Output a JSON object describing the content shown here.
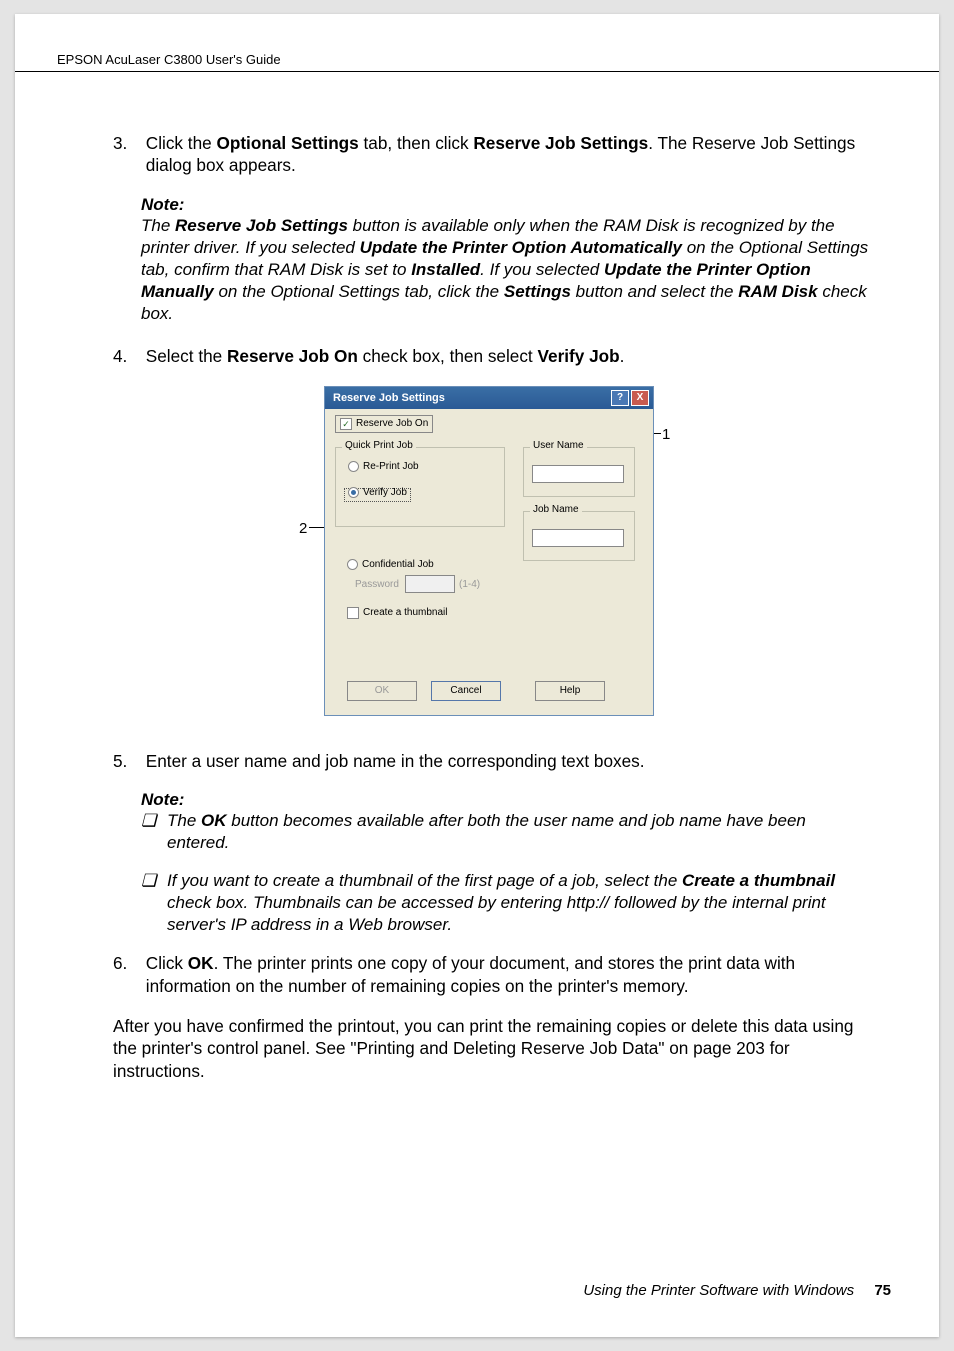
{
  "header": "EPSON AcuLaser C3800     User's Guide",
  "step3_num": "3.",
  "step3_text_a": "Click the ",
  "step3_bold_a": "Optional Settings",
  "step3_text_b": " tab, then click ",
  "step3_bold_b": "Reserve Job Settings",
  "step3_text_c": ". The Reserve Job Settings dialog box appears.",
  "note_label": "Note:",
  "note1_a": "The ",
  "note1_b": "Reserve Job Settings",
  "note1_c": " button is available only when the RAM Disk is recognized by the printer driver. If you selected ",
  "note1_d": "Update the Printer Option Automatically",
  "note1_e": " on the Optional Settings tab, confirm that RAM Disk is set to ",
  "note1_f": "Installed",
  "note1_g": ". If you selected ",
  "note1_h": "Update the Printer Option Manually",
  "note1_i": " on the Optional Settings tab, click the ",
  "note1_j": "Settings",
  "note1_k": " button and select the ",
  "note1_l": "RAM Disk",
  "note1_m": " check box.",
  "step4_num": "4.",
  "step4_a": "Select the ",
  "step4_b": "Reserve Job On",
  "step4_c": " check box, then select ",
  "step4_d": "Verify Job",
  "step4_e": ".",
  "callout1": "1",
  "callout2": "2",
  "dialog": {
    "title": "Reserve Job Settings",
    "help": "?",
    "close": "X",
    "reserve_on": "Reserve Job On",
    "quick": "Quick Print Job",
    "reprint": "Re-Print Job",
    "verify": "Verify Job",
    "confidential": "Confidential Job",
    "password": "Password",
    "pwhint": "(1-4)",
    "thumb": "Create a thumbnail",
    "username": "User Name",
    "jobname": "Job Name",
    "ok": "OK",
    "cancel": "Cancel",
    "helpbtn": "Help"
  },
  "step5_num": "5.",
  "step5": "Enter a user name and job name in the corresponding text boxes.",
  "bullet1_a": "The ",
  "bullet1_b": "OK",
  "bullet1_c": " button becomes available after both the user name and job name have been entered.",
  "bullet2_a": "If you want to create a thumbnail of the first page of a job, select the ",
  "bullet2_b": "Create a thumbnail",
  "bullet2_c": " check box. Thumbnails can be accessed by entering http:// followed by the internal print server's IP address in a Web browser.",
  "step6_num": "6.",
  "step6_a": "Click ",
  "step6_b": "OK",
  "step6_c": ". The printer prints one copy of your document, and stores the print data with information on the number of remaining copies on the printer's memory.",
  "closing": "After you have confirmed the printout, you can print the remaining copies or delete this data using the printer's control panel. See \"Printing and Deleting Reserve Job Data\" on page 203 for instructions.",
  "footer_text": "Using the Printer Software with Windows",
  "footer_page": "75"
}
